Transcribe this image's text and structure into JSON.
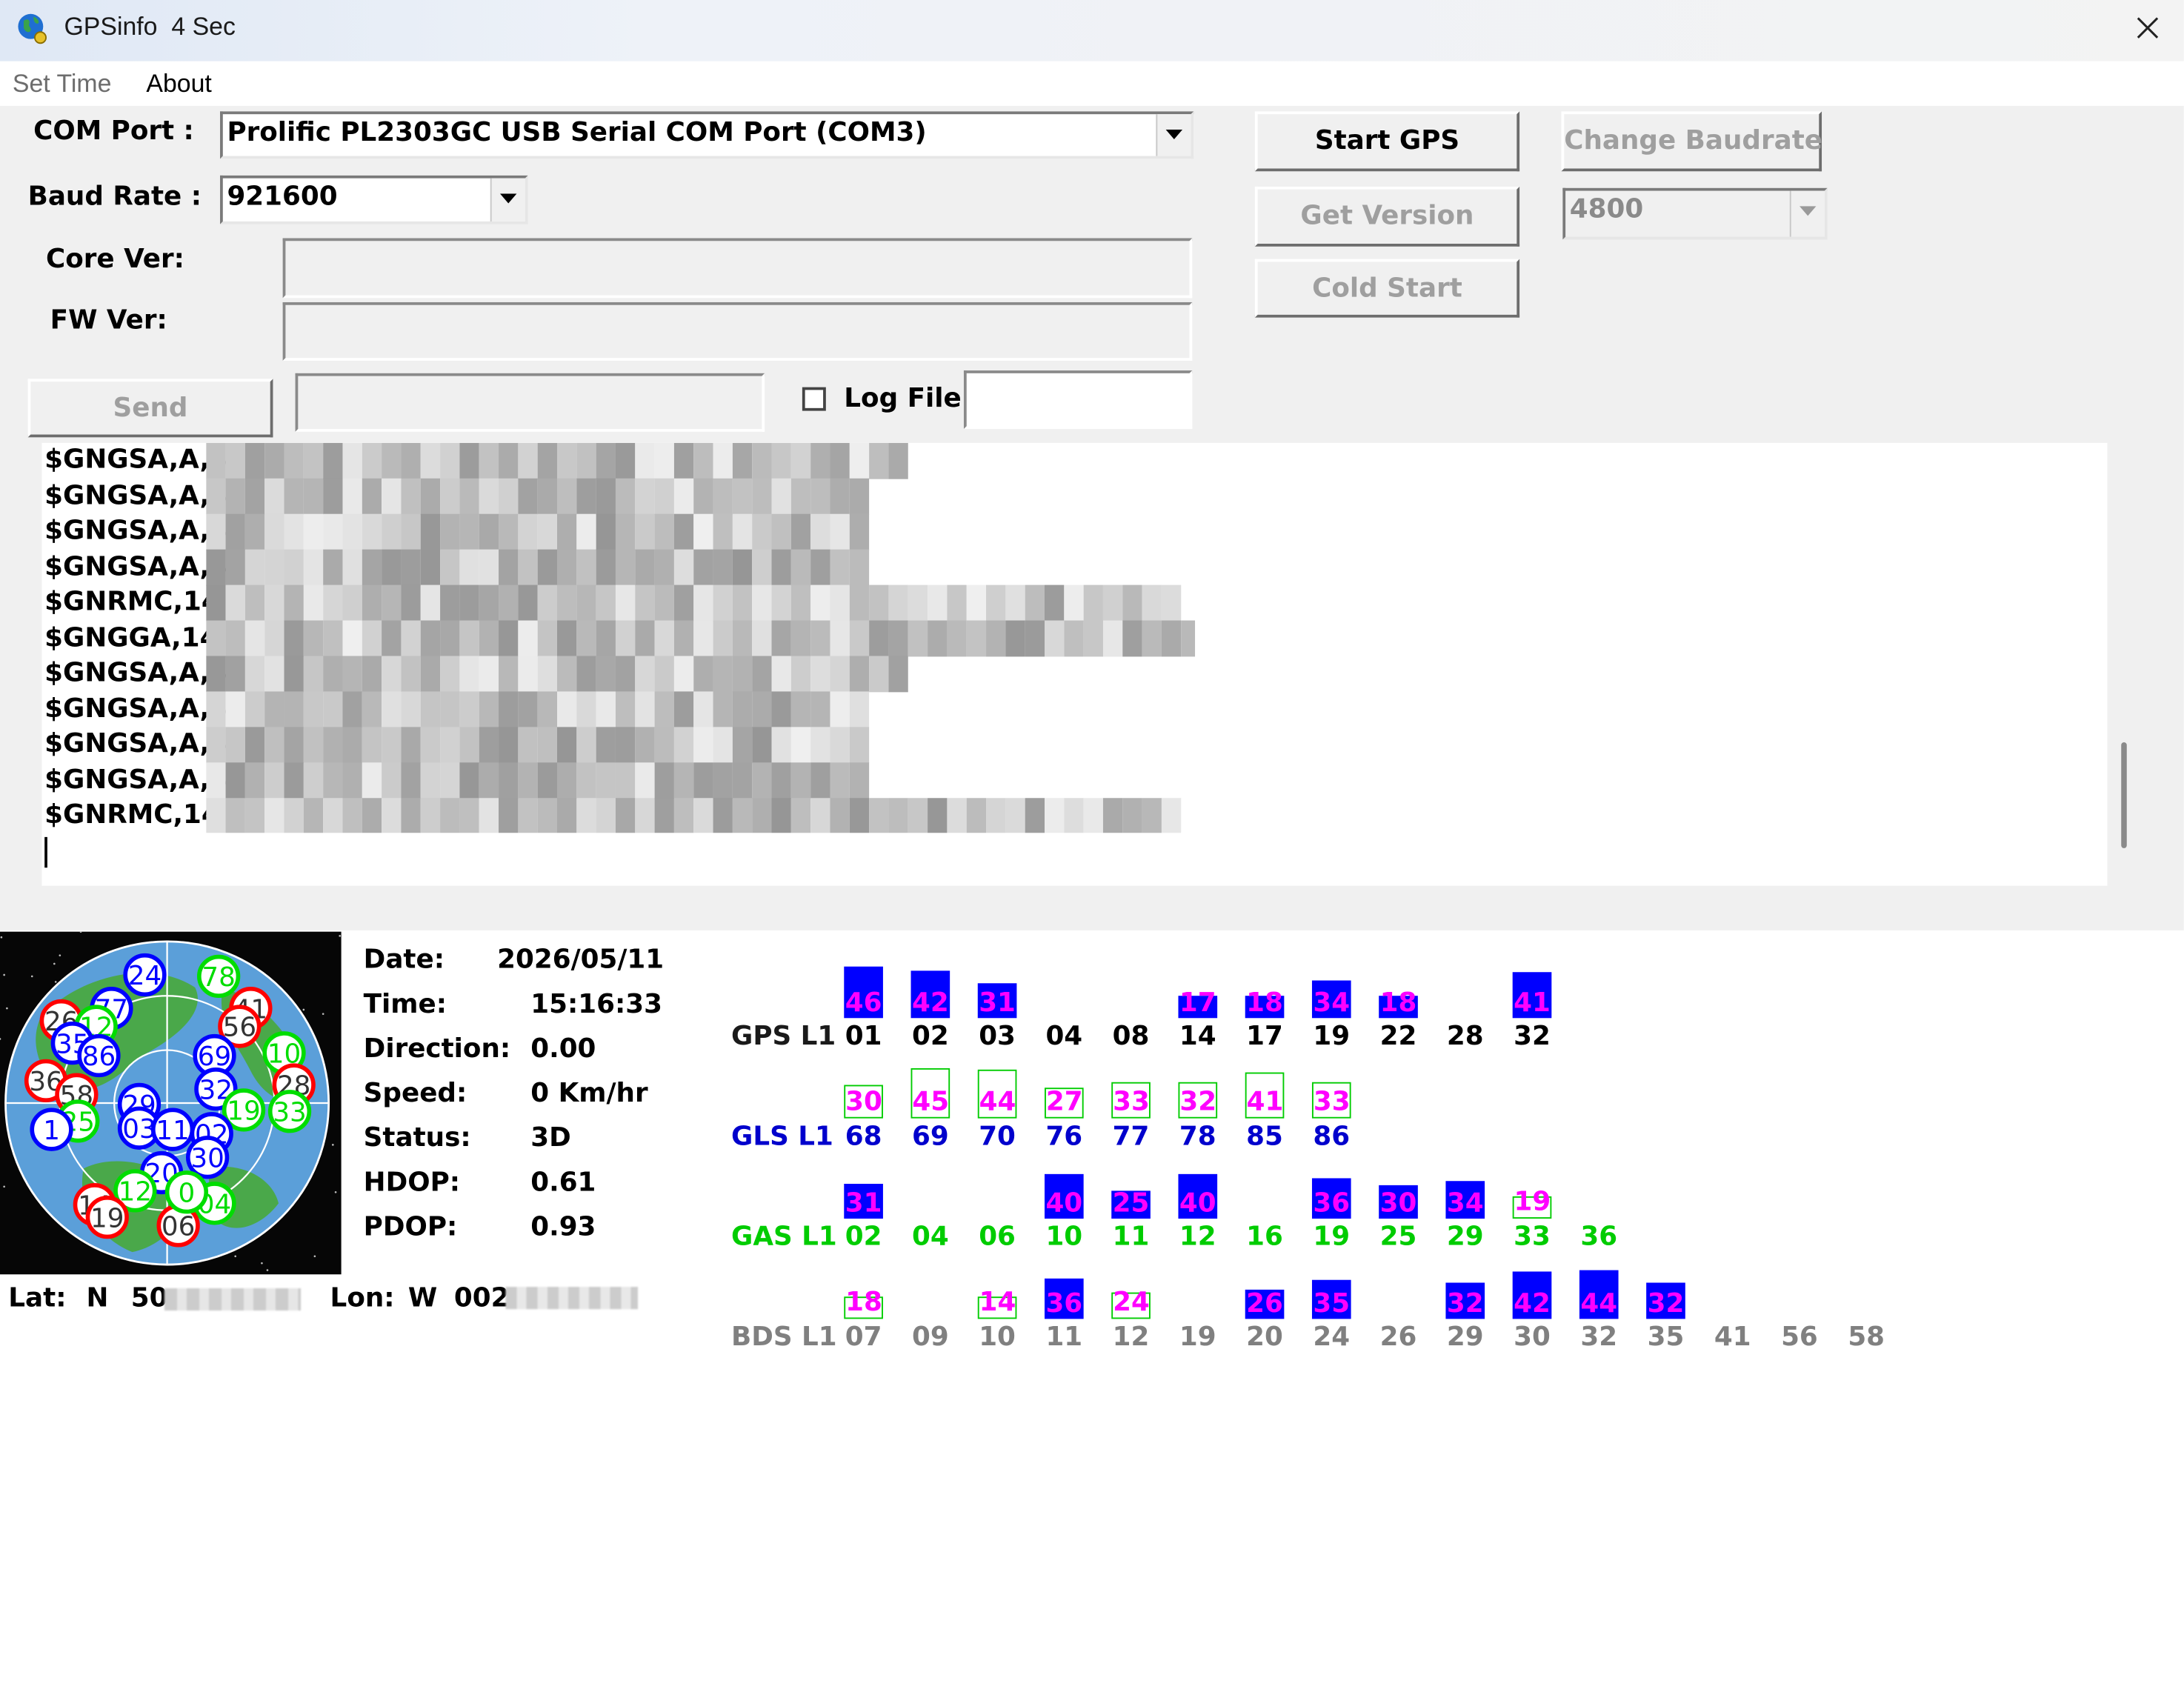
{
  "window": {
    "title": "GPSinfo",
    "interval": "4 Sec"
  },
  "menu": [
    "Set Time",
    "About"
  ],
  "com_port": {
    "label": "COM Port :",
    "value": "Prolific PL2303GC USB Serial COM Port (COM3)"
  },
  "baud_rate": {
    "label": "Baud Rate :",
    "value": "921600"
  },
  "core_ver": {
    "label": "Core Ver:",
    "value": ""
  },
  "fw_ver": {
    "label": "FW Ver:",
    "value": ""
  },
  "buttons": {
    "start_gps": "Start GPS",
    "change_baudrate": "Change Baudrate",
    "get_version": "Get Version",
    "cold_start": "Cold Start",
    "send": "Send"
  },
  "change_baud_value": "4800",
  "send_input": "",
  "log_file": {
    "label": "Log File",
    "checked": false,
    "value": ""
  },
  "nmea_log": [
    "$GNGSA,A,3",
    "$GNGSA,A,3",
    "$GNGSA,A,3",
    "$GNGSA,A,3",
    "$GNRMC,14",
    "$GNGGA,14",
    "$GNGSA,A,3",
    "$GNGSA,A,3",
    "$GNGSA,A,3",
    "$GNGSA,A,3",
    "$GNRMC,14"
  ],
  "nav": {
    "date_label": "Date:",
    "date": "2026/05/11",
    "time_label": "Time:",
    "time": "15:16:33",
    "direction_label": "Direction:",
    "direction": "0.00",
    "speed_label": "Speed:",
    "speed": "0 Km/hr",
    "status_label": "Status:",
    "status": "3D",
    "hdop_label": "HDOP:",
    "hdop": "0.61",
    "pdop_label": "PDOP:",
    "pdop": "0.93",
    "lat_label": "Lat:",
    "lat_hemi": "N",
    "lat_prefix": "50",
    "lon_label": "Lon:",
    "lon_hemi": "W",
    "lon_prefix": "002"
  },
  "colors": {
    "gps": "#0000ff",
    "glonass": "#00dd00",
    "galileo": "#00dd00",
    "beidou": "#808080",
    "snr": "#ff00ff",
    "used_bar": "#0000ff"
  },
  "constellations": [
    {
      "name": "GPS L1",
      "color": "#1a1a1a",
      "prn_color": "#000000",
      "sats": [
        {
          "prn": "01",
          "snr": 46,
          "used": true
        },
        {
          "prn": "02",
          "snr": 42,
          "used": true
        },
        {
          "prn": "03",
          "snr": 31,
          "used": true
        },
        {
          "prn": "04",
          "snr": null,
          "used": false
        },
        {
          "prn": "08",
          "snr": null,
          "used": false
        },
        {
          "prn": "14",
          "snr": 17,
          "used": true
        },
        {
          "prn": "17",
          "snr": 18,
          "used": true
        },
        {
          "prn": "19",
          "snr": 34,
          "used": true
        },
        {
          "prn": "22",
          "snr": 18,
          "used": true
        },
        {
          "prn": "28",
          "snr": null,
          "used": false
        },
        {
          "prn": "32",
          "snr": 41,
          "used": true
        }
      ]
    },
    {
      "name": "GLS L1",
      "color": "#0000cc",
      "prn_color": "#0000cc",
      "sats": [
        {
          "prn": "68",
          "snr": 30,
          "used": false
        },
        {
          "prn": "69",
          "snr": 45,
          "used": false
        },
        {
          "prn": "70",
          "snr": 44,
          "used": false
        },
        {
          "prn": "76",
          "snr": 27,
          "used": false
        },
        {
          "prn": "77",
          "snr": 33,
          "used": false
        },
        {
          "prn": "78",
          "snr": 32,
          "used": false
        },
        {
          "prn": "85",
          "snr": 41,
          "used": false
        },
        {
          "prn": "86",
          "snr": 33,
          "used": false
        }
      ]
    },
    {
      "name": "GAS L1",
      "color": "#00cc00",
      "prn_color": "#00cc00",
      "sats": [
        {
          "prn": "02",
          "snr": 31,
          "used": true
        },
        {
          "prn": "04",
          "snr": null,
          "used": false
        },
        {
          "prn": "06",
          "snr": null,
          "used": false
        },
        {
          "prn": "10",
          "snr": 40,
          "used": true
        },
        {
          "prn": "11",
          "snr": 25,
          "used": true
        },
        {
          "prn": "12",
          "snr": 40,
          "used": true
        },
        {
          "prn": "16",
          "snr": null,
          "used": false
        },
        {
          "prn": "19",
          "snr": 36,
          "used": true
        },
        {
          "prn": "25",
          "snr": 30,
          "used": true
        },
        {
          "prn": "29",
          "snr": 34,
          "used": true
        },
        {
          "prn": "33",
          "snr": 19,
          "used": false
        },
        {
          "prn": "36",
          "snr": null,
          "used": false
        }
      ]
    },
    {
      "name": "BDS L1",
      "color": "#808080",
      "prn_color": "#808080",
      "sats": [
        {
          "prn": "07",
          "snr": 18,
          "used": false
        },
        {
          "prn": "09",
          "snr": null,
          "used": false
        },
        {
          "prn": "10",
          "snr": 14,
          "used": false
        },
        {
          "prn": "11",
          "snr": 36,
          "used": true
        },
        {
          "prn": "12",
          "snr": 24,
          "used": false
        },
        {
          "prn": "19",
          "snr": null,
          "used": false
        },
        {
          "prn": "20",
          "snr": 26,
          "used": true
        },
        {
          "prn": "24",
          "snr": 35,
          "used": true
        },
        {
          "prn": "26",
          "snr": null,
          "used": false
        },
        {
          "prn": "29",
          "snr": 32,
          "used": true
        },
        {
          "prn": "30",
          "snr": 42,
          "used": true
        },
        {
          "prn": "32",
          "snr": 44,
          "used": true
        },
        {
          "prn": "35",
          "snr": 32,
          "used": true
        },
        {
          "prn": "41",
          "snr": null,
          "used": false
        },
        {
          "prn": "56",
          "snr": null,
          "used": false
        },
        {
          "prn": "58",
          "snr": null,
          "used": false
        }
      ]
    }
  ],
  "sky_sats": [
    {
      "prn": "24",
      "c": "#0000ff"
    },
    {
      "prn": "78",
      "c": "#00dd00"
    },
    {
      "prn": "77",
      "c": "#0000ff"
    },
    {
      "prn": "41",
      "c": "#ff0000"
    },
    {
      "prn": "26",
      "c": "#ff0000"
    },
    {
      "prn": "12",
      "c": "#00dd00"
    },
    {
      "prn": "56",
      "c": "#ff0000"
    },
    {
      "prn": "35",
      "c": "#0000ff"
    },
    {
      "prn": "86",
      "c": "#0000ff"
    },
    {
      "prn": "69",
      "c": "#0000ff"
    },
    {
      "prn": "10",
      "c": "#00dd00"
    },
    {
      "prn": "36",
      "c": "#ff0000"
    },
    {
      "prn": "58",
      "c": "#ff0000"
    },
    {
      "prn": "28",
      "c": "#ff0000"
    },
    {
      "prn": "29",
      "c": "#0000ff"
    },
    {
      "prn": "32",
      "c": "#0000ff"
    },
    {
      "prn": "25",
      "c": "#00dd00"
    },
    {
      "prn": "19",
      "c": "#00dd00"
    },
    {
      "prn": "33",
      "c": "#00dd00"
    },
    {
      "prn": "1",
      "c": "#0000ff"
    },
    {
      "prn": "03",
      "c": "#0000ff"
    },
    {
      "prn": "11",
      "c": "#0000ff"
    },
    {
      "prn": "02",
      "c": "#0000ff"
    },
    {
      "prn": "30",
      "c": "#0000ff"
    },
    {
      "prn": "20",
      "c": "#0000ff"
    },
    {
      "prn": "12",
      "c": "#00dd00"
    },
    {
      "prn": "04",
      "c": "#00dd00"
    },
    {
      "prn": "14",
      "c": "#ff0000"
    },
    {
      "prn": "19",
      "c": "#ff0000"
    },
    {
      "prn": "06",
      "c": "#ff0000"
    },
    {
      "prn": "0",
      "c": "#00dd00"
    }
  ]
}
